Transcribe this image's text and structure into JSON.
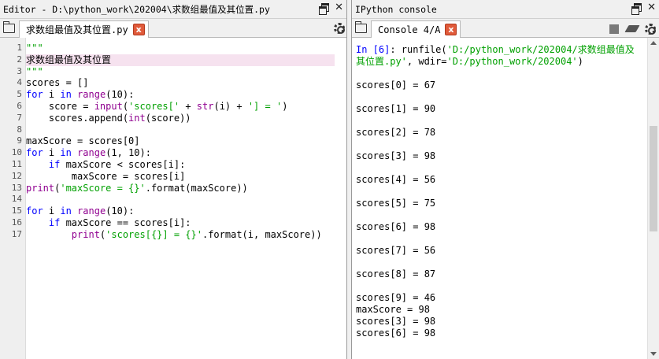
{
  "editor": {
    "title": "Editor - D:\\python_work\\202004\\求数组最值及其位置.py",
    "tab_label": "求数组最值及其位置.py",
    "line_numbers": [
      "1",
      "2",
      "3",
      "4",
      "5",
      "6",
      "7",
      "8",
      "9",
      "10",
      "11",
      "12",
      "13",
      "14",
      "15",
      "16",
      "17"
    ],
    "code": [
      [
        {
          "t": "\"\"\"",
          "c": "str"
        }
      ],
      [
        {
          "t": "求数组最值及其位置",
          "c": ""
        }
      ],
      [
        {
          "t": "\"\"\"",
          "c": "str"
        }
      ],
      [
        {
          "t": "scores = []",
          "c": ""
        }
      ],
      [
        {
          "t": "for",
          "c": "kw"
        },
        {
          "t": " i ",
          "c": ""
        },
        {
          "t": "in",
          "c": "kw"
        },
        {
          "t": " ",
          "c": ""
        },
        {
          "t": "range",
          "c": "bi"
        },
        {
          "t": "(10):",
          "c": ""
        }
      ],
      [
        {
          "t": "    score = ",
          "c": ""
        },
        {
          "t": "input",
          "c": "bi"
        },
        {
          "t": "(",
          "c": ""
        },
        {
          "t": "'scores['",
          "c": "str"
        },
        {
          "t": " + ",
          "c": ""
        },
        {
          "t": "str",
          "c": "bi"
        },
        {
          "t": "(i) + ",
          "c": ""
        },
        {
          "t": "'] = '",
          "c": "str"
        },
        {
          "t": ")",
          "c": ""
        }
      ],
      [
        {
          "t": "    scores.append(",
          "c": ""
        },
        {
          "t": "int",
          "c": "bi"
        },
        {
          "t": "(score))",
          "c": ""
        }
      ],
      [
        {
          "t": "",
          "c": ""
        }
      ],
      [
        {
          "t": "maxScore = scores[0]",
          "c": ""
        }
      ],
      [
        {
          "t": "for",
          "c": "kw"
        },
        {
          "t": " i ",
          "c": ""
        },
        {
          "t": "in",
          "c": "kw"
        },
        {
          "t": " ",
          "c": ""
        },
        {
          "t": "range",
          "c": "bi"
        },
        {
          "t": "(1, 10):",
          "c": ""
        }
      ],
      [
        {
          "t": "    ",
          "c": ""
        },
        {
          "t": "if",
          "c": "kw"
        },
        {
          "t": " maxScore < scores[i]:",
          "c": ""
        }
      ],
      [
        {
          "t": "        maxScore = scores[i]",
          "c": ""
        }
      ],
      [
        {
          "t": "print",
          "c": "bi"
        },
        {
          "t": "(",
          "c": ""
        },
        {
          "t": "'maxScore = {}'",
          "c": "str"
        },
        {
          "t": ".format(maxScore))",
          "c": ""
        }
      ],
      [
        {
          "t": "",
          "c": ""
        }
      ],
      [
        {
          "t": "for",
          "c": "kw"
        },
        {
          "t": " i ",
          "c": ""
        },
        {
          "t": "in",
          "c": "kw"
        },
        {
          "t": " ",
          "c": ""
        },
        {
          "t": "range",
          "c": "bi"
        },
        {
          "t": "(10):",
          "c": ""
        }
      ],
      [
        {
          "t": "    ",
          "c": ""
        },
        {
          "t": "if",
          "c": "kw"
        },
        {
          "t": " maxScore == scores[i]:",
          "c": ""
        }
      ],
      [
        {
          "t": "        ",
          "c": ""
        },
        {
          "t": "print",
          "c": "bi"
        },
        {
          "t": "(",
          "c": ""
        },
        {
          "t": "'scores[{}] = {}'",
          "c": "str"
        },
        {
          "t": ".format(i, maxScore))",
          "c": ""
        }
      ]
    ],
    "highlighted_line": 2
  },
  "console": {
    "title": "IPython console",
    "tab_label": "Console 4/A",
    "lines": [
      [
        {
          "t": "In [6]",
          "c": "prompt"
        },
        {
          "t": ": runfile(",
          "c": ""
        },
        {
          "t": "'D:/python_work/202004/求数组最值及",
          "c": "str"
        }
      ],
      [
        {
          "t": "其位置.py'",
          "c": "str"
        },
        {
          "t": ", wdir=",
          "c": ""
        },
        {
          "t": "'D:/python_work/202004'",
          "c": "str"
        },
        {
          "t": ")",
          "c": ""
        }
      ],
      [
        {
          "t": "",
          "c": ""
        }
      ],
      [
        {
          "t": "scores[0] = 67",
          "c": ""
        }
      ],
      [
        {
          "t": "",
          "c": ""
        }
      ],
      [
        {
          "t": "scores[1] = 90",
          "c": ""
        }
      ],
      [
        {
          "t": "",
          "c": ""
        }
      ],
      [
        {
          "t": "scores[2] = 78",
          "c": ""
        }
      ],
      [
        {
          "t": "",
          "c": ""
        }
      ],
      [
        {
          "t": "scores[3] = 98",
          "c": ""
        }
      ],
      [
        {
          "t": "",
          "c": ""
        }
      ],
      [
        {
          "t": "scores[4] = 56",
          "c": ""
        }
      ],
      [
        {
          "t": "",
          "c": ""
        }
      ],
      [
        {
          "t": "scores[5] = 75",
          "c": ""
        }
      ],
      [
        {
          "t": "",
          "c": ""
        }
      ],
      [
        {
          "t": "scores[6] = 98",
          "c": ""
        }
      ],
      [
        {
          "t": "",
          "c": ""
        }
      ],
      [
        {
          "t": "scores[7] = 56",
          "c": ""
        }
      ],
      [
        {
          "t": "",
          "c": ""
        }
      ],
      [
        {
          "t": "scores[8] = 87",
          "c": ""
        }
      ],
      [
        {
          "t": "",
          "c": ""
        }
      ],
      [
        {
          "t": "scores[9] = 46",
          "c": ""
        }
      ],
      [
        {
          "t": "maxScore = 98",
          "c": ""
        }
      ],
      [
        {
          "t": "scores[3] = 98",
          "c": ""
        }
      ],
      [
        {
          "t": "scores[6] = 98",
          "c": ""
        }
      ]
    ]
  },
  "icons": {
    "undock": "undock-icon",
    "close": "close-icon",
    "browse": "folder-icon",
    "tab_close": "tab-close-icon",
    "options": "gear-icon",
    "interrupt": "stop-icon",
    "clear": "eraser-icon"
  },
  "symbols": {
    "close_glyph": "✕",
    "tab_close_glyph": "x"
  }
}
